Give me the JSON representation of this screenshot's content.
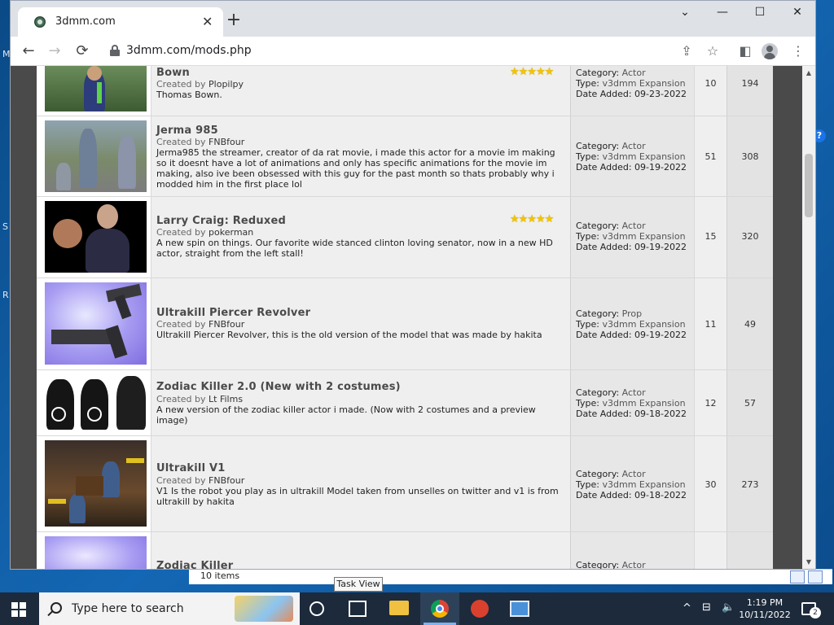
{
  "desktop": {
    "left_letters": [
      "M",
      "S",
      "R"
    ]
  },
  "browser": {
    "tab_title": "3dmm.com",
    "url": "3dmm.com/mods.php",
    "controls": {
      "minimize": "⌄",
      "min": "—",
      "max": "☐",
      "close": "✕"
    }
  },
  "mods": [
    {
      "title": "Bown",
      "creator": "Plopilpy",
      "description": "Thomas Bown.",
      "rated": true,
      "category": "Actor",
      "type": "v3dmm Expansion",
      "date_added": "09-23-2022",
      "n1": "10",
      "n2": "194"
    },
    {
      "title": "Jerma 985",
      "creator": "FNBfour",
      "description": "Jerma985 the streamer, creator of da rat movie, i made this actor for a movie im making so it doesnt have a lot of animations and only has specific animations for the movie im making, also ive been obsessed with this guy for the past month so thats probably why i modded him in the first place lol",
      "rated": false,
      "category": "Actor",
      "type": "v3dmm Expansion",
      "date_added": "09-19-2022",
      "n1": "51",
      "n2": "308"
    },
    {
      "title": "Larry Craig: Reduxed",
      "creator": "pokerman",
      "description": "A new spin on things. Our favorite wide stanced clinton loving senator, now in a new HD actor, straight from the left stall!",
      "rated": true,
      "category": "Actor",
      "type": "v3dmm Expansion",
      "date_added": "09-19-2022",
      "n1": "15",
      "n2": "320"
    },
    {
      "title": "Ultrakill Piercer Revolver",
      "creator": "FNBfour",
      "description": "Ultrakill Piercer Revolver, this is the old version of the model that was made by hakita",
      "rated": false,
      "category": "Prop",
      "type": "v3dmm Expansion",
      "date_added": "09-19-2022",
      "n1": "11",
      "n2": "49"
    },
    {
      "title": "Zodiac Killer 2.0 (New with 2 costumes)",
      "creator": "Lt Films",
      "description": "A new version of the zodiac killer actor i made. (Now with 2 costumes and a preview image)",
      "rated": false,
      "category": "Actor",
      "type": "v3dmm Expansion",
      "date_added": "09-18-2022",
      "n1": "12",
      "n2": "57"
    },
    {
      "title": "Ultrakill V1",
      "creator": "FNBfour",
      "description": "V1 Is the robot you play as in ultrakill Model taken from unselles on twitter and v1 is from ultrakill by hakita",
      "rated": false,
      "category": "Actor",
      "type": "v3dmm Expansion",
      "date_added": "09-18-2022",
      "n1": "30",
      "n2": "273"
    },
    {
      "title": "Zodiac Killer",
      "creator": "",
      "description": "",
      "rated": false,
      "category": "Actor",
      "type": "",
      "date_added": "",
      "n1": "",
      "n2": ""
    }
  ],
  "labels": {
    "created_by": "Created by",
    "category": "Category:",
    "type": "Type:",
    "date_added": "Date Added:",
    "stars": "★★★★★"
  },
  "statusbar": {
    "items": "10 items"
  },
  "tooltip": "Task View",
  "taskbar": {
    "search_placeholder": "Type here to search",
    "time": "1:19 PM",
    "date": "10/11/2022",
    "notification_count": "2"
  }
}
